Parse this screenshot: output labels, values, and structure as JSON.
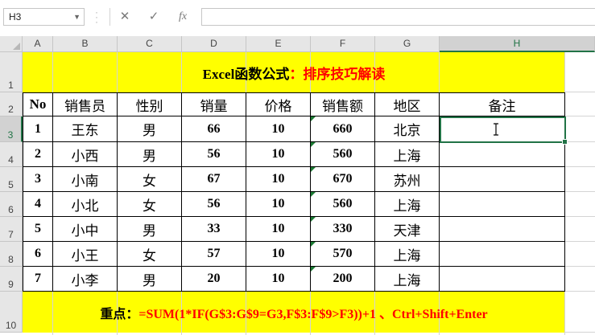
{
  "formula_bar": {
    "name_box": "H3",
    "cancel_icon": "✕",
    "enter_icon": "✓",
    "fx_label": "fx",
    "formula": ""
  },
  "columns": [
    "A",
    "B",
    "C",
    "D",
    "E",
    "F",
    "G",
    "H"
  ],
  "selected_column": "H",
  "rows": [
    "1",
    "2",
    "3",
    "4",
    "5",
    "6",
    "7",
    "8",
    "9",
    "10"
  ],
  "selected_row": "3",
  "title": {
    "prefix": "Excel函数公式",
    "colon": "：",
    "suffix": "排序技巧解读"
  },
  "table": {
    "headers": [
      "No",
      "销售员",
      "性别",
      "销量",
      "价格",
      "销售额",
      "地区",
      "备注"
    ],
    "rows": [
      [
        "1",
        "王东",
        "男",
        "66",
        "10",
        "660",
        "北京",
        ""
      ],
      [
        "2",
        "小西",
        "男",
        "56",
        "10",
        "560",
        "上海",
        ""
      ],
      [
        "3",
        "小南",
        "女",
        "67",
        "10",
        "670",
        "苏州",
        ""
      ],
      [
        "4",
        "小北",
        "女",
        "56",
        "10",
        "560",
        "上海",
        ""
      ],
      [
        "5",
        "小中",
        "男",
        "33",
        "10",
        "330",
        "天津",
        ""
      ],
      [
        "6",
        "小王",
        "女",
        "57",
        "10",
        "570",
        "上海",
        ""
      ],
      [
        "7",
        "小李",
        "男",
        "20",
        "10",
        "200",
        "上海",
        ""
      ]
    ]
  },
  "footer": {
    "label": "重点：",
    "formula": "=SUM(1*IF(G$3:G$9=G3,F$3:F$9>F3))+1 、Ctrl+Shift+Enter"
  },
  "colors": {
    "band": "#ffff00",
    "accent_red": "#ff0000",
    "excel_green": "#217346"
  }
}
